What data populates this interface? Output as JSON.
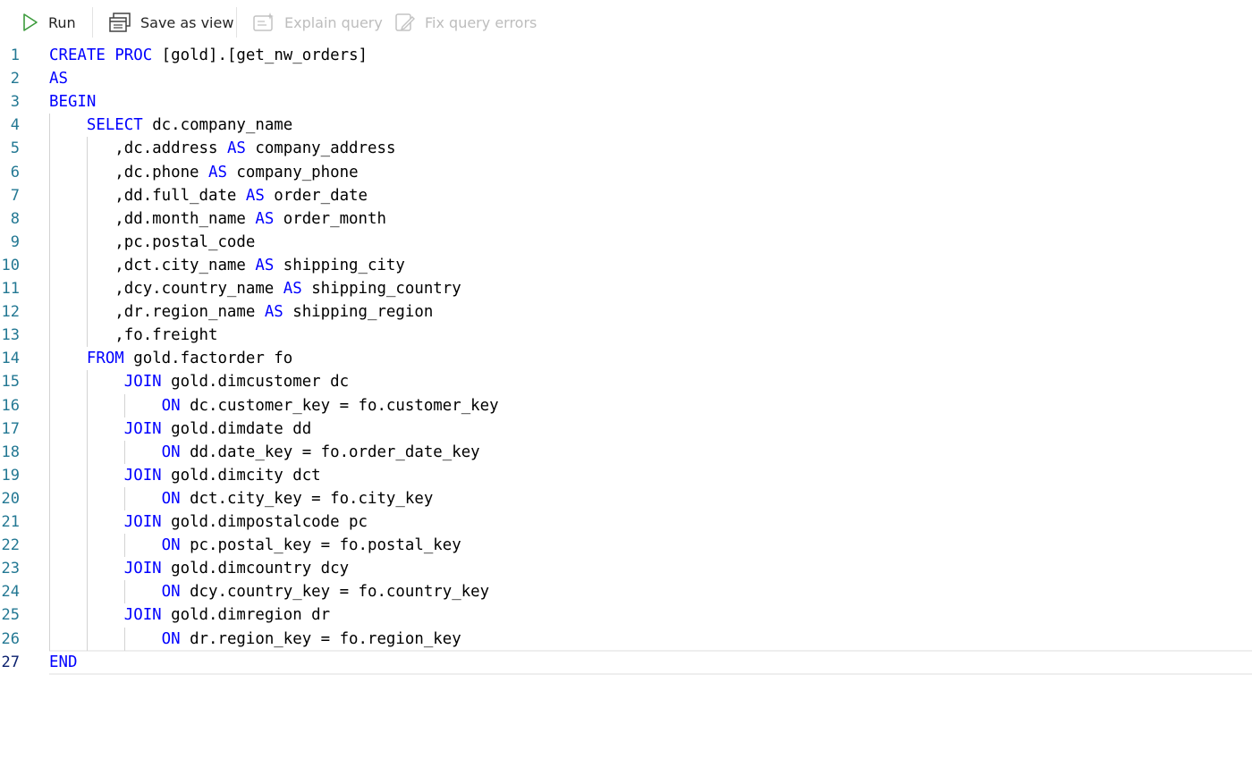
{
  "toolbar": {
    "run_label": "Run",
    "save_view_label": "Save as view",
    "explain_label": "Explain query",
    "fix_label": "Fix query errors"
  },
  "editor": {
    "active_line": 27,
    "lines": [
      [
        {
          "t": "CREATE",
          "k": 1
        },
        {
          "t": " "
        },
        {
          "t": "PROC",
          "k": 1
        },
        {
          "t": " [gold].[get_nw_orders]"
        }
      ],
      [
        {
          "t": "AS",
          "k": 1
        }
      ],
      [
        {
          "t": "BEGIN",
          "k": 1
        }
      ],
      [
        {
          "t": "    "
        },
        {
          "t": "SELECT",
          "k": 1
        },
        {
          "t": " dc.company_name"
        }
      ],
      [
        {
          "t": "       ,dc.address "
        },
        {
          "t": "AS",
          "k": 1
        },
        {
          "t": " company_address"
        }
      ],
      [
        {
          "t": "       ,dc.phone "
        },
        {
          "t": "AS",
          "k": 1
        },
        {
          "t": " company_phone"
        }
      ],
      [
        {
          "t": "       ,dd.full_date "
        },
        {
          "t": "AS",
          "k": 1
        },
        {
          "t": " order_date"
        }
      ],
      [
        {
          "t": "       ,dd.month_name "
        },
        {
          "t": "AS",
          "k": 1
        },
        {
          "t": " order_month"
        }
      ],
      [
        {
          "t": "       ,pc.postal_code"
        }
      ],
      [
        {
          "t": "       ,dct.city_name "
        },
        {
          "t": "AS",
          "k": 1
        },
        {
          "t": " shipping_city"
        }
      ],
      [
        {
          "t": "       ,dcy.country_name "
        },
        {
          "t": "AS",
          "k": 1
        },
        {
          "t": " shipping_country"
        }
      ],
      [
        {
          "t": "       ,dr.region_name "
        },
        {
          "t": "AS",
          "k": 1
        },
        {
          "t": " shipping_region"
        }
      ],
      [
        {
          "t": "       ,fo.freight"
        }
      ],
      [
        {
          "t": "    "
        },
        {
          "t": "FROM",
          "k": 1
        },
        {
          "t": " gold.factorder fo"
        }
      ],
      [
        {
          "t": "        "
        },
        {
          "t": "JOIN",
          "k": 1
        },
        {
          "t": " gold.dimcustomer dc"
        }
      ],
      [
        {
          "t": "            "
        },
        {
          "t": "ON",
          "k": 1
        },
        {
          "t": " dc.customer_key = fo.customer_key"
        }
      ],
      [
        {
          "t": "        "
        },
        {
          "t": "JOIN",
          "k": 1
        },
        {
          "t": " gold.dimdate dd"
        }
      ],
      [
        {
          "t": "            "
        },
        {
          "t": "ON",
          "k": 1
        },
        {
          "t": " dd.date_key = fo.order_date_key"
        }
      ],
      [
        {
          "t": "        "
        },
        {
          "t": "JOIN",
          "k": 1
        },
        {
          "t": " gold.dimcity dct"
        }
      ],
      [
        {
          "t": "            "
        },
        {
          "t": "ON",
          "k": 1
        },
        {
          "t": " dct.city_key = fo.city_key"
        }
      ],
      [
        {
          "t": "        "
        },
        {
          "t": "JOIN",
          "k": 1
        },
        {
          "t": " gold.dimpostalcode pc"
        }
      ],
      [
        {
          "t": "            "
        },
        {
          "t": "ON",
          "k": 1
        },
        {
          "t": " pc.postal_key = fo.postal_key"
        }
      ],
      [
        {
          "t": "        "
        },
        {
          "t": "JOIN",
          "k": 1
        },
        {
          "t": " gold.dimcountry dcy"
        }
      ],
      [
        {
          "t": "            "
        },
        {
          "t": "ON",
          "k": 1
        },
        {
          "t": " dcy.country_key = fo.country_key"
        }
      ],
      [
        {
          "t": "        "
        },
        {
          "t": "JOIN",
          "k": 1
        },
        {
          "t": " gold.dimregion dr"
        }
      ],
      [
        {
          "t": "            "
        },
        {
          "t": "ON",
          "k": 1
        },
        {
          "t": " dr.region_key = fo.region_key"
        }
      ],
      [
        {
          "t": "END",
          "k": 1
        }
      ]
    ]
  }
}
